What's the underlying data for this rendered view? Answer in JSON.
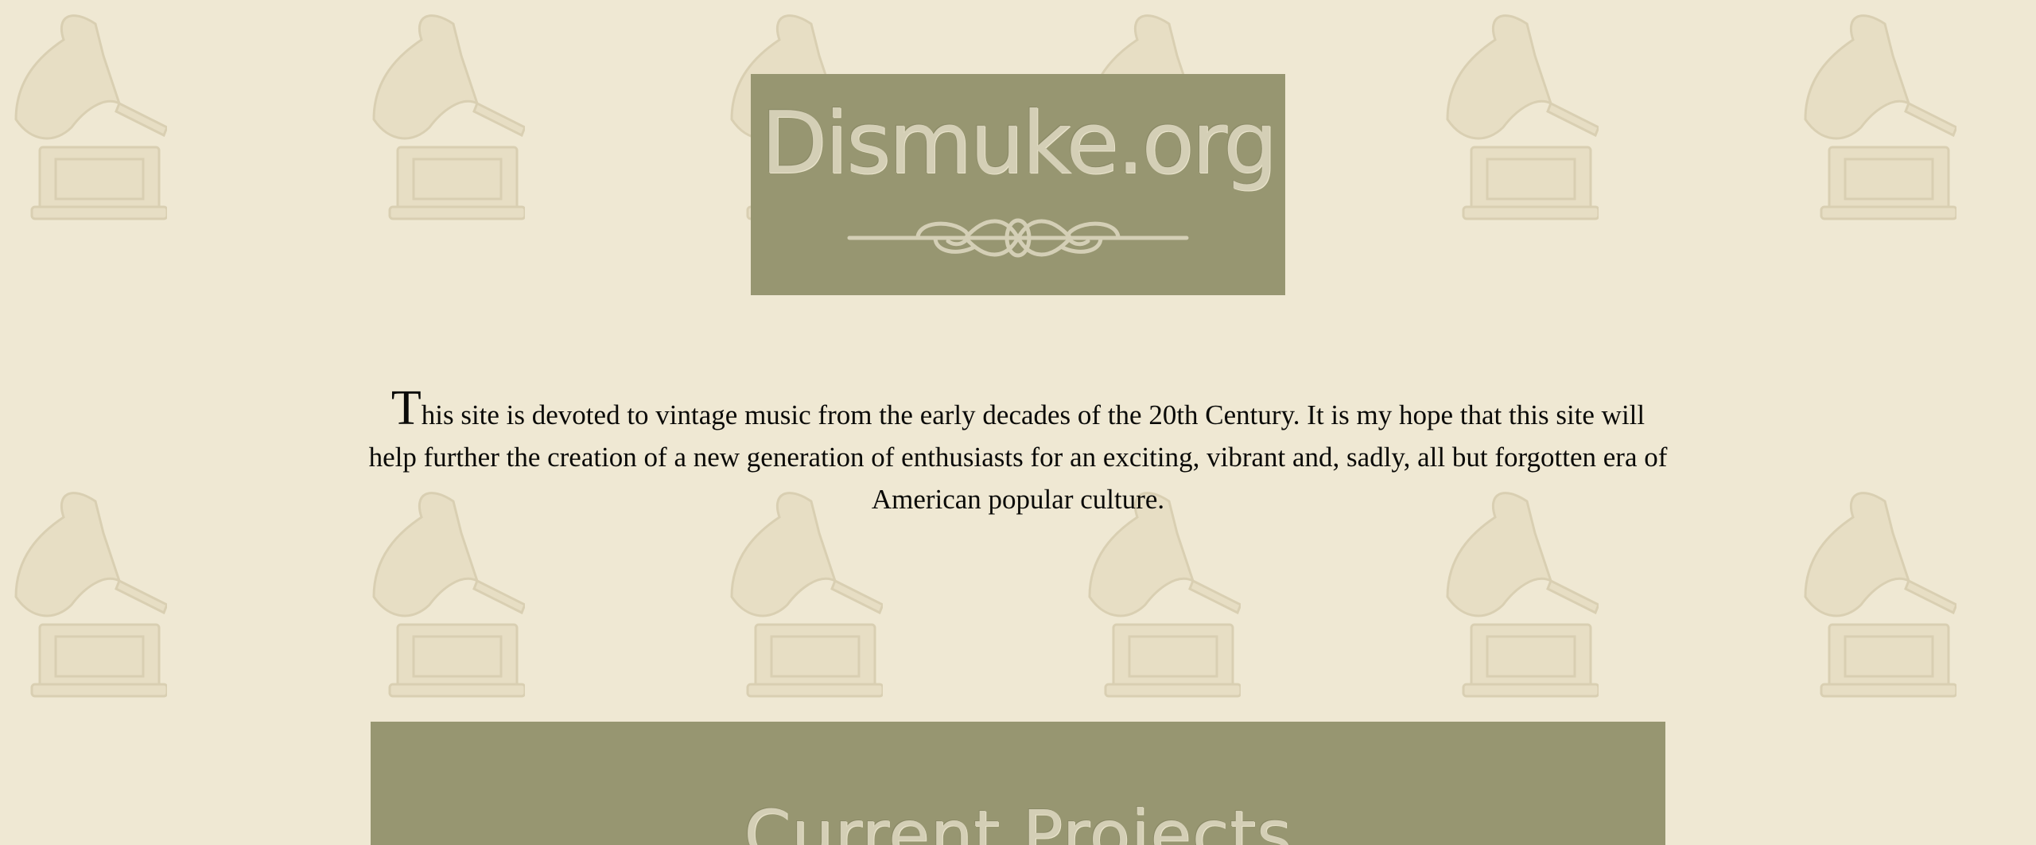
{
  "background": {
    "color": "#efe8d3",
    "motif_icon": "gramophone-icon",
    "motif_color": "#e7dec4"
  },
  "logo": {
    "text": "Dismuke.org",
    "flourish_icon": "ornamental-flourish-icon",
    "banner_color": "#979671",
    "text_color": "#d4cfb6"
  },
  "intro": {
    "drop_cap": "T",
    "text": "his site is devoted to vintage music from the early decades of the 20th Century. It is my hope that this site will help further the creation of a new generation of enthusiasts for an exciting, vibrant and, sadly, all but forgotten era of American popular culture."
  },
  "section": {
    "title": "Current Projects",
    "banner_color": "#979671"
  }
}
